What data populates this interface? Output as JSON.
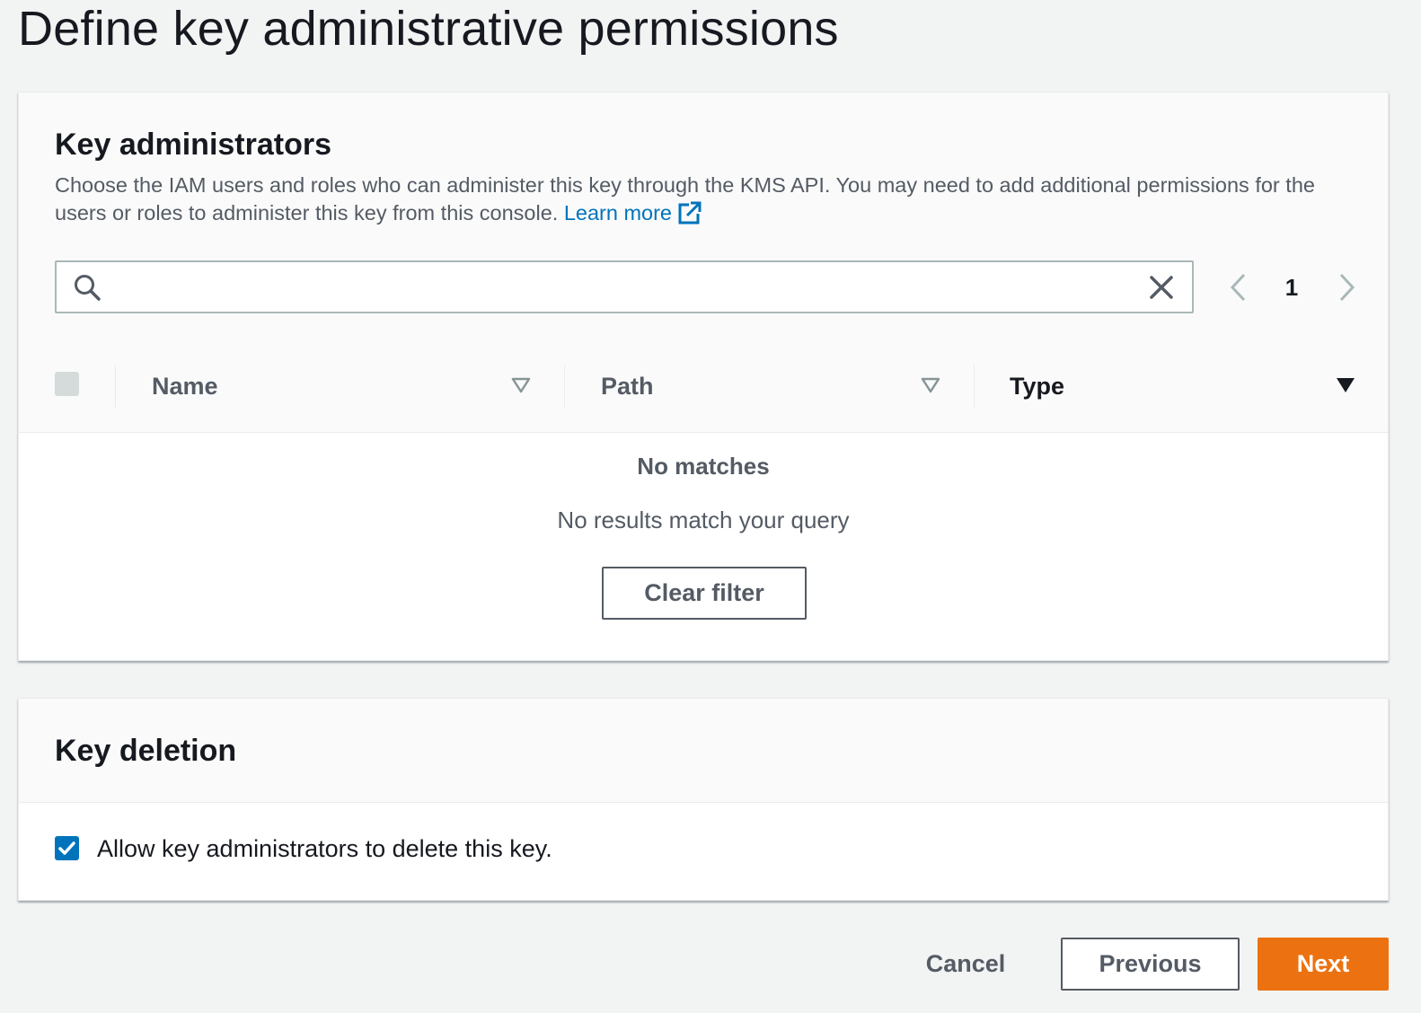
{
  "page": {
    "title": "Define key administrative permissions"
  },
  "key_administrators": {
    "title": "Key administrators",
    "description": "Choose the IAM users and roles who can administer this key through the KMS API. You may need to add additional permissions for the users or roles to administer this key from this console.",
    "learn_more_label": "Learn more",
    "search": {
      "value": "",
      "placeholder": ""
    },
    "pagination": {
      "current_page": "1"
    },
    "table": {
      "columns": [
        "Name",
        "Path",
        "Type"
      ],
      "sorted_column": "Type",
      "rows": []
    },
    "empty_state": {
      "title": "No matches",
      "message": "No results match your query",
      "clear_filter_label": "Clear filter"
    }
  },
  "key_deletion": {
    "title": "Key deletion",
    "allow_delete_label": "Allow key administrators to delete this key.",
    "allow_delete_checked": true
  },
  "footer": {
    "cancel_label": "Cancel",
    "previous_label": "Previous",
    "next_label": "Next"
  },
  "colors": {
    "primary": "#ec7211",
    "link": "#0073bb",
    "checkbox_checked": "#0073bb",
    "background": "#f2f3f3"
  },
  "icons": [
    "search-icon",
    "clear-icon",
    "external-link-icon",
    "chevron-left-icon",
    "chevron-right-icon",
    "sort-icon",
    "checkmark-icon"
  ]
}
